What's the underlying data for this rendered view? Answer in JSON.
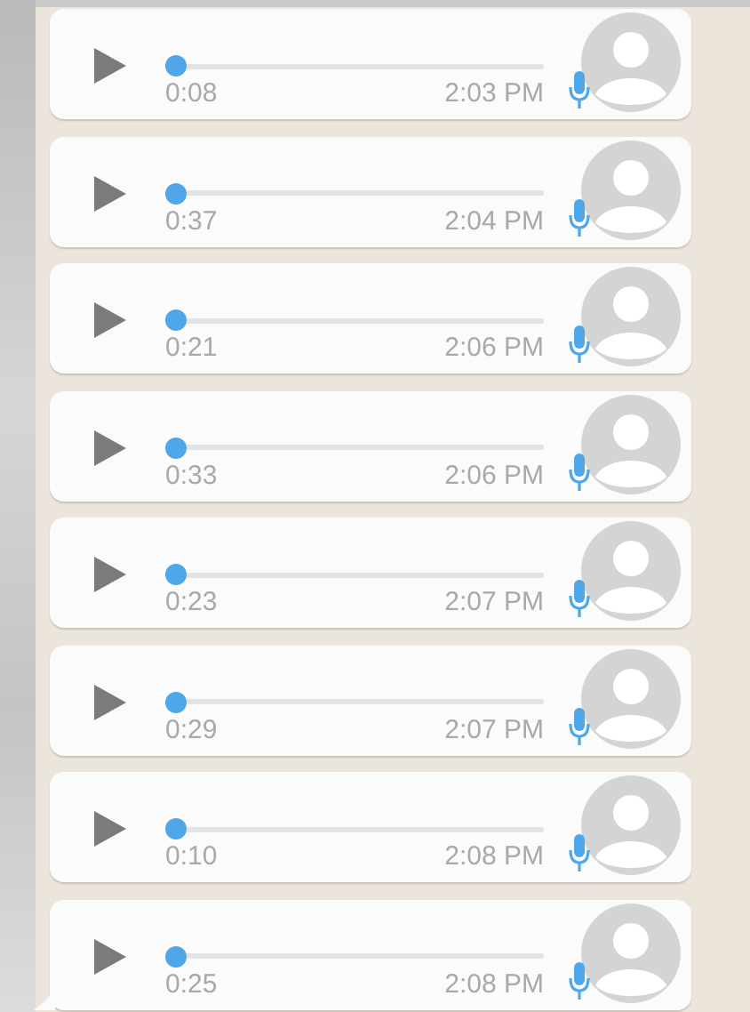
{
  "messages": [
    {
      "duration": "0:08",
      "time": "2:03 PM",
      "level": 0
    },
    {
      "duration": "0:37",
      "time": "2:04 PM",
      "level": 0
    },
    {
      "duration": "0:21",
      "time": "2:06 PM",
      "level": 0
    },
    {
      "duration": "0:33",
      "time": "2:06 PM",
      "level": 0
    },
    {
      "duration": "0:23",
      "time": "2:07 PM",
      "level": 0
    },
    {
      "duration": "0:29",
      "time": "2:07 PM",
      "level": 0
    },
    {
      "duration": "0:10",
      "time": "2:08 PM",
      "level": 0
    },
    {
      "duration": "0:25",
      "time": "2:08 PM",
      "level": 0
    }
  ]
}
